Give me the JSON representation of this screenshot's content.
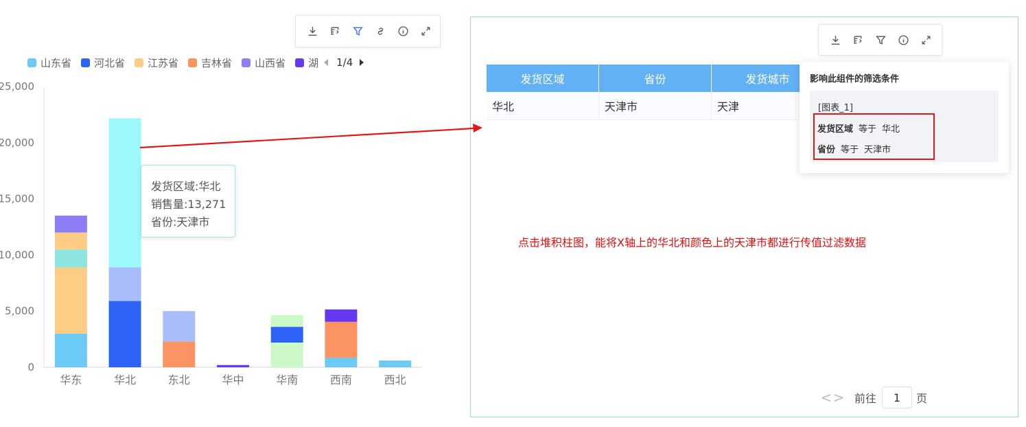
{
  "chart_toolbar": {
    "icons": [
      "download-icon",
      "data-view-icon",
      "filter-icon",
      "link-icon",
      "info-icon",
      "expand-icon"
    ]
  },
  "legend": {
    "items": [
      {
        "label": "山东省",
        "color": "#6ccaf7"
      },
      {
        "label": "河北省",
        "color": "#2e64f5"
      },
      {
        "label": "江苏省",
        "color": "#fdcd86"
      },
      {
        "label": "吉林省",
        "color": "#fc9363"
      },
      {
        "label": "山西省",
        "color": "#8d7ef6"
      },
      {
        "label": "湖",
        "color": "#6638f0"
      }
    ],
    "page": "1/4"
  },
  "chart_data": {
    "type": "bar",
    "stacked": true,
    "categories": [
      "华东",
      "华北",
      "东北",
      "华中",
      "华南",
      "西南",
      "西北"
    ],
    "yticks": [
      "0",
      "5,000",
      "10,000",
      "15,000",
      "20,000",
      "25,000"
    ],
    "ylim": [
      0,
      25000
    ],
    "segments": [
      [
        {
          "value": 3000,
          "color": "#6ccaf7"
        },
        {
          "value": 5900,
          "color": "#fdcd86"
        },
        {
          "value": 1600,
          "color": "#8ee5e0"
        },
        {
          "value": 1500,
          "color": "#fdcd86"
        },
        {
          "value": 1500,
          "color": "#8d7ef6"
        }
      ],
      [
        {
          "value": 5900,
          "color": "#2e64f5"
        },
        {
          "value": 3000,
          "color": "#a9bdfb"
        },
        {
          "value": 13271,
          "color": "#9ef9fc"
        }
      ],
      [
        {
          "value": 2300,
          "color": "#fc9363"
        },
        {
          "value": 2700,
          "color": "#a9bdfb"
        }
      ],
      [
        {
          "value": 200,
          "color": "#6638f0"
        }
      ],
      [
        {
          "value": 2200,
          "color": "#cdf8c8"
        },
        {
          "value": 1400,
          "color": "#2e64f5"
        },
        {
          "value": 1050,
          "color": "#cdf8c8"
        }
      ],
      [
        {
          "value": 850,
          "color": "#6ccaf7"
        },
        {
          "value": 3200,
          "color": "#fc9363"
        },
        {
          "value": 1100,
          "color": "#6638f0"
        }
      ],
      [
        {
          "value": 600,
          "color": "#6ccaf7"
        }
      ]
    ]
  },
  "tooltip": {
    "lines": [
      "发货区域:华北",
      "销售量:13,271",
      "省份:天津市"
    ]
  },
  "table": {
    "headers": [
      "发货区域",
      "省份",
      "发货城市"
    ],
    "rows": [
      [
        "华北",
        "天津市",
        "天津"
      ]
    ]
  },
  "table_toolbar": {
    "icons": [
      "download-icon",
      "data-view-icon",
      "filter-icon",
      "info-icon",
      "expand-icon"
    ]
  },
  "filter_popup": {
    "title": "影响此组件的筛选条件",
    "chart_name": "[图表_1]",
    "conditions": [
      {
        "field": "发货区域",
        "op": "等于",
        "value": "华北"
      },
      {
        "field": "省份",
        "op": "等于",
        "value": "天津市"
      }
    ]
  },
  "note": "点击堆积柱图，能将X轴上的华北和颜色上的天津市都进行传值过滤数据",
  "pagination": {
    "prev": "<",
    "next": ">",
    "goto_label": "前往",
    "page_value": "1",
    "page_suffix": "页"
  },
  "colors": {
    "arrow_red": "#e01818",
    "header_blue": "#61b1f4",
    "tooltip_border": "#9fe6ee"
  }
}
